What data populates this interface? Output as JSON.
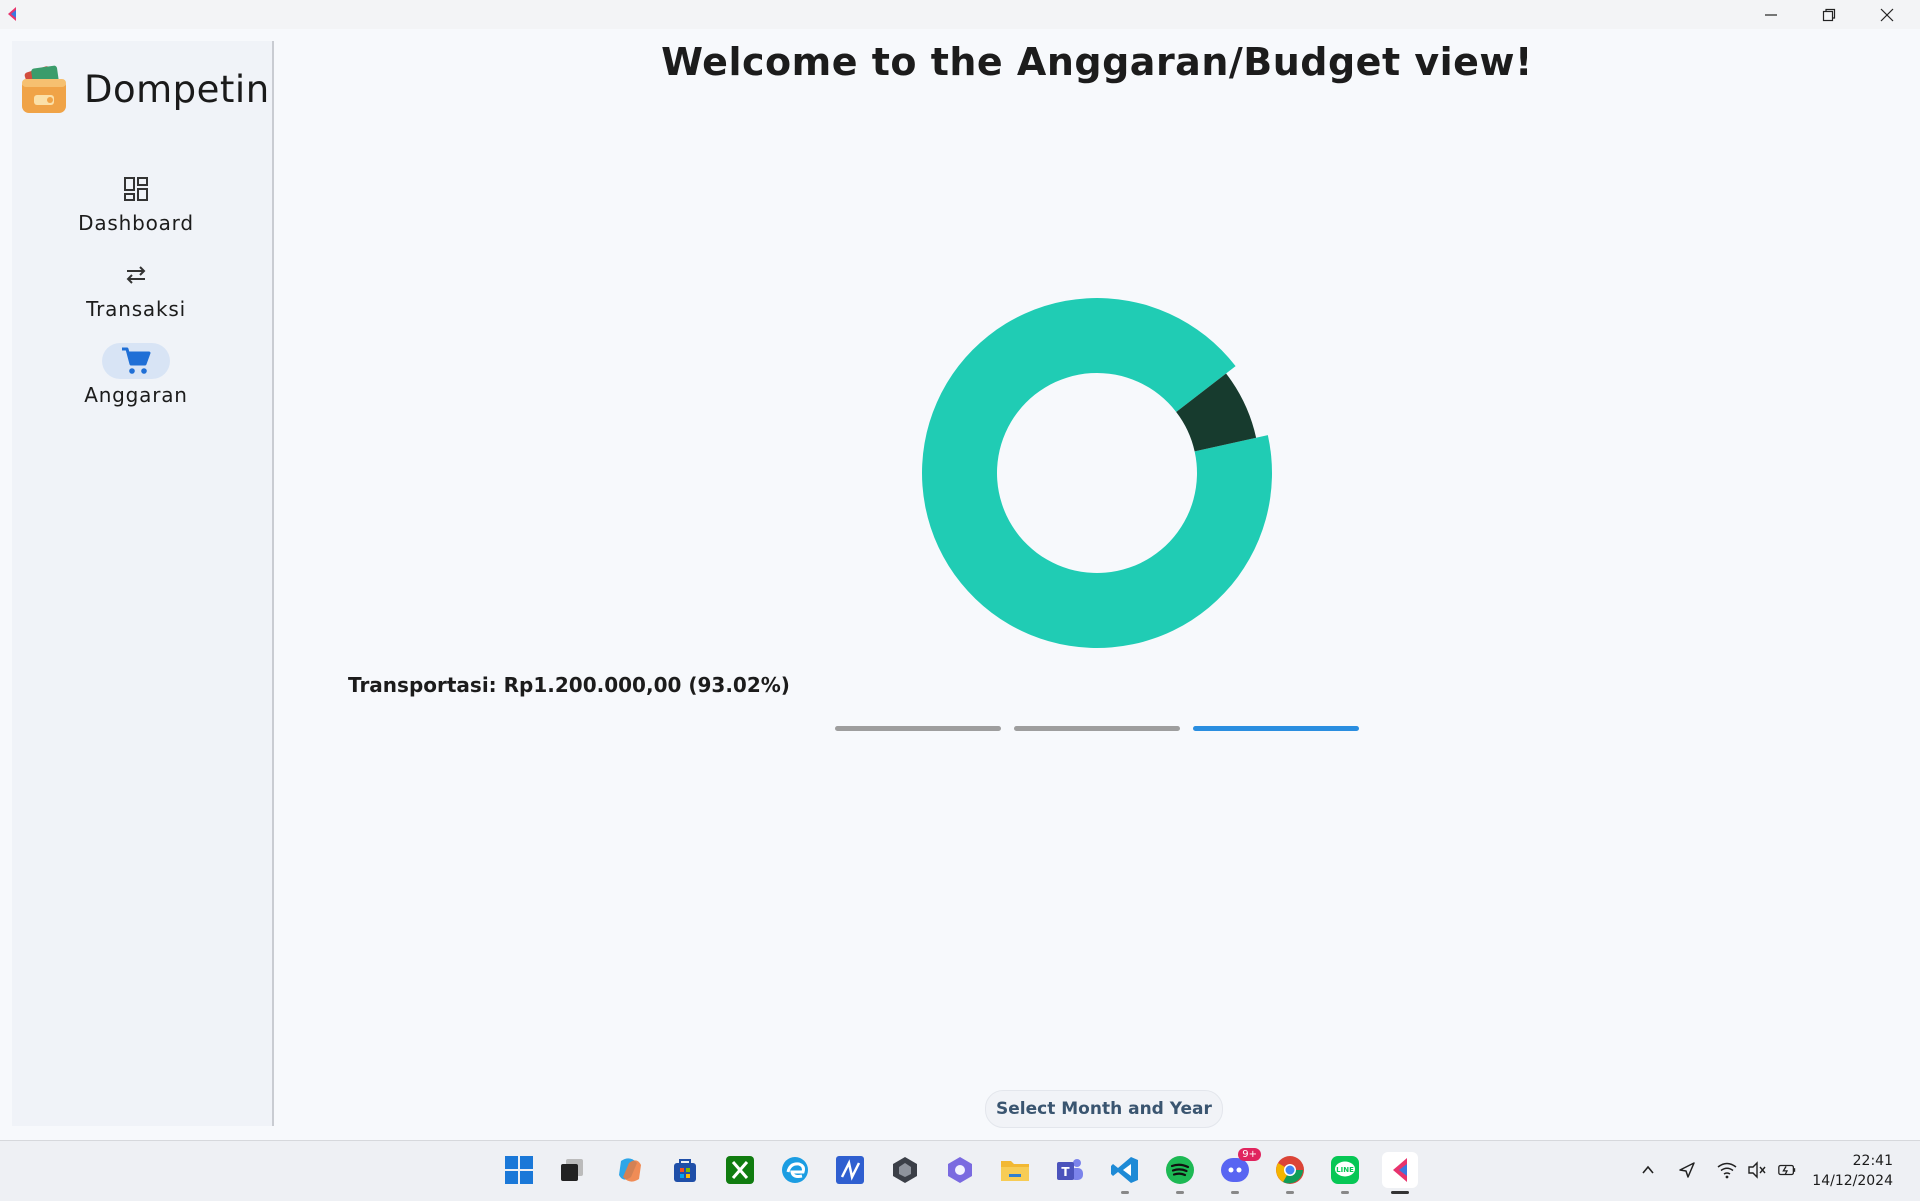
{
  "window": {
    "app_icon": "dompetin-app-icon",
    "controls": {
      "minimize": "minimize-icon",
      "restore": "restore-icon",
      "close": "close-icon"
    }
  },
  "sidebar": {
    "brand": {
      "name": "Dompetin",
      "logo": "wallet-logo"
    },
    "items": [
      {
        "label": "Dashboard",
        "icon": "dashboard-grid-icon",
        "active": false
      },
      {
        "label": "Transaksi",
        "icon": "swap-arrows-icon",
        "active": false
      },
      {
        "label": "Anggaran",
        "icon": "shopping-cart-icon",
        "active": true
      }
    ]
  },
  "main": {
    "title": "Welcome to the Anggaran/Budget view!",
    "caption": "Transportasi: Rp1.200.000,00 (93.02%)",
    "page_indicator": {
      "pages": 3,
      "current": 3
    },
    "select_button_label": "Select Month and Year"
  },
  "chart_data": {
    "type": "pie",
    "style": "donut",
    "slices": [
      {
        "value": 93.02,
        "color": "#20ccb4"
      },
      {
        "value": 6.98,
        "color": "#173b2e"
      }
    ],
    "start_angle_deg": -12.5,
    "highlighted_slice": 1
  },
  "taskbar": {
    "apps": [
      "windows-start-icon",
      "task-view-icon",
      "copilot-icon",
      "microsoft-store-icon",
      "xbox-icon",
      "edge-icon",
      "visual-studio-icon",
      "unity-icon",
      "photos-icon",
      "file-explorer-icon",
      "teams-icon",
      "vscode-icon",
      "spotify-icon",
      "discord-icon",
      "chrome-icon",
      "line-icon",
      "dompetin-taskbar-icon"
    ],
    "discord_badge": "9+",
    "tray": [
      "chevron-up-icon",
      "location-icon",
      "wifi-icon",
      "speaker-muted-icon",
      "battery-icon"
    ],
    "time": "22:41",
    "date": "14/12/2024"
  },
  "colors": {
    "accent": "#2a8ee0",
    "donut_main": "#20ccb4",
    "donut_dark": "#173b2e",
    "nav_active_bg": "#d8e4f5"
  }
}
